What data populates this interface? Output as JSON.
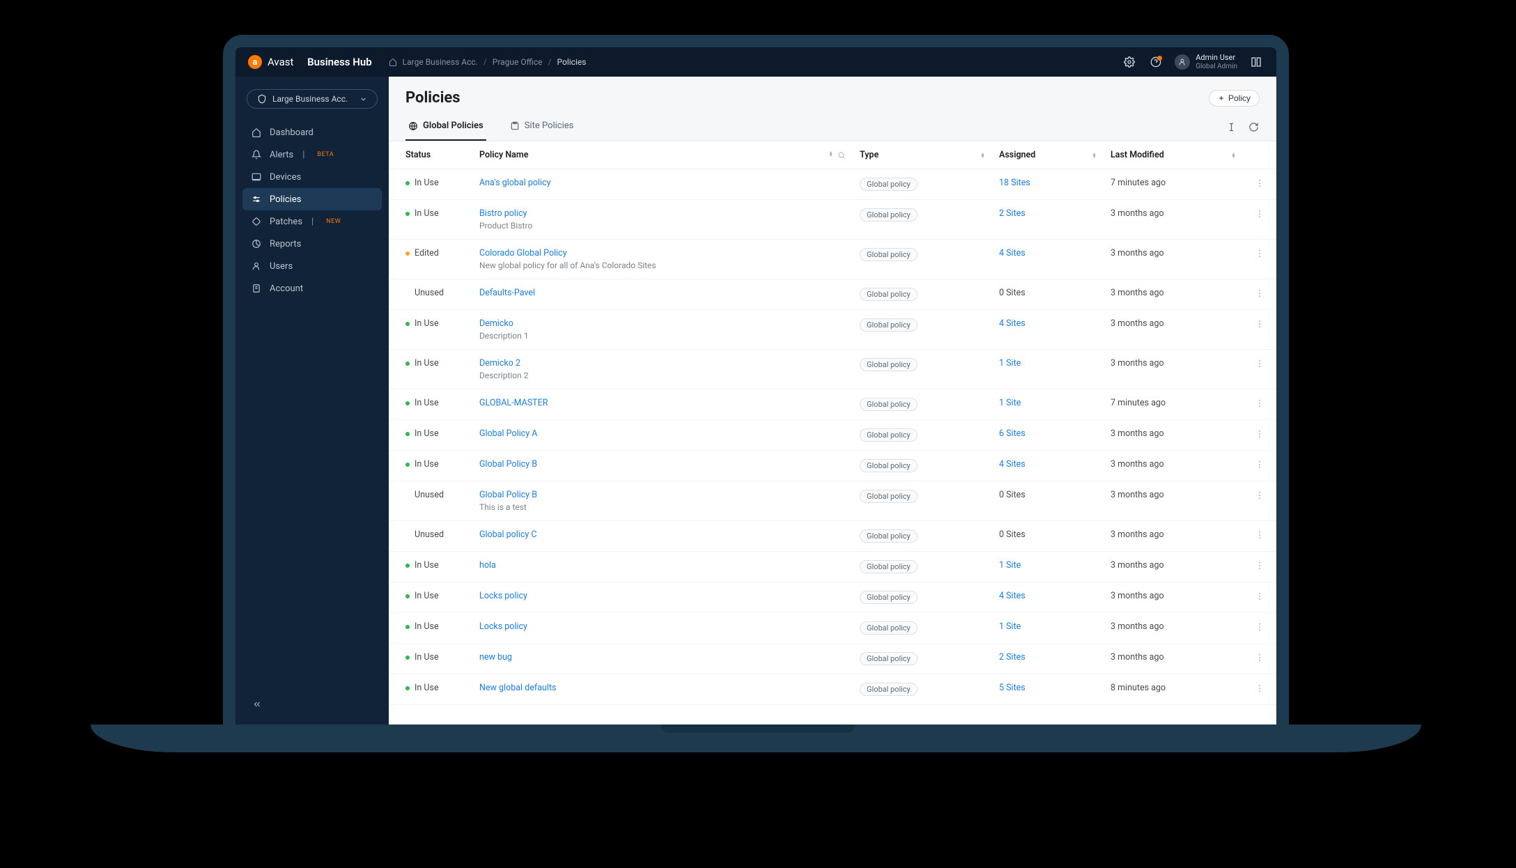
{
  "brand": {
    "name_light": "Avast",
    "name_bold": "Business Hub"
  },
  "breadcrumbs": {
    "home_label": "Large Business Acc.",
    "mid_label": "Prague Office",
    "current": "Policies"
  },
  "user": {
    "name": "Admin User",
    "role": "Global Admin"
  },
  "sidebar": {
    "org_label": "Large Business Acc.",
    "items": [
      {
        "label": "Dashboard",
        "icon": "home",
        "badge": ""
      },
      {
        "label": "Alerts",
        "icon": "bell",
        "badge": "BETA"
      },
      {
        "label": "Devices",
        "icon": "monitor",
        "badge": ""
      },
      {
        "label": "Policies",
        "icon": "sliders",
        "badge": "",
        "active": true
      },
      {
        "label": "Patches",
        "icon": "patch",
        "badge": "NEW"
      },
      {
        "label": "Reports",
        "icon": "chart",
        "badge": ""
      },
      {
        "label": "Users",
        "icon": "user",
        "badge": ""
      },
      {
        "label": "Account",
        "icon": "doc",
        "badge": ""
      }
    ]
  },
  "page": {
    "title": "Policies",
    "add_button": "Policy",
    "tabs": [
      {
        "label": "Global Policies",
        "active": true
      },
      {
        "label": "Site Policies",
        "active": false
      }
    ]
  },
  "table": {
    "headers": {
      "status": "Status",
      "name": "Policy Name",
      "type": "Type",
      "assigned": "Assigned",
      "modified": "Last Modified"
    },
    "rows": [
      {
        "status": "In Use",
        "status_dot": "green",
        "name": "Ana's global policy",
        "desc": "",
        "type": "Global policy",
        "assigned": "18 Sites",
        "assigned_nonzero": true,
        "modified": "7 minutes ago"
      },
      {
        "status": "In Use",
        "status_dot": "green",
        "name": "Bistro policy",
        "desc": "Product Bistro",
        "type": "Global policy",
        "assigned": "2 Sites",
        "assigned_nonzero": true,
        "modified": "3 months ago"
      },
      {
        "status": "Edited",
        "status_dot": "orange",
        "name": "Colorado Global Policy",
        "desc": "New global policy for all of Ana's Colorado Sites",
        "type": "Global policy",
        "assigned": "4 Sites",
        "assigned_nonzero": true,
        "modified": "3 months ago"
      },
      {
        "status": "Unused",
        "status_dot": "none",
        "name": "Defaults-Pavel",
        "desc": "",
        "type": "Global policy",
        "assigned": "0 Sites",
        "assigned_nonzero": false,
        "modified": "3 months ago"
      },
      {
        "status": "In Use",
        "status_dot": "green",
        "name": "Demicko",
        "desc": "Description 1",
        "type": "Global policy",
        "assigned": "4 Sites",
        "assigned_nonzero": true,
        "modified": "3 months ago"
      },
      {
        "status": "In Use",
        "status_dot": "green",
        "name": "Demicko 2",
        "desc": "Description 2",
        "type": "Global policy",
        "assigned": "1 Site",
        "assigned_nonzero": true,
        "modified": "3 months ago"
      },
      {
        "status": "In Use",
        "status_dot": "green",
        "name": "GLOBAL-MASTER",
        "desc": "",
        "type": "Global policy",
        "assigned": "1 Site",
        "assigned_nonzero": true,
        "modified": "7 minutes ago"
      },
      {
        "status": "In Use",
        "status_dot": "green",
        "name": "Global Policy A",
        "desc": "",
        "type": "Global policy",
        "assigned": "6 Sites",
        "assigned_nonzero": true,
        "modified": "3 months ago"
      },
      {
        "status": "In Use",
        "status_dot": "green",
        "name": "Global Policy B",
        "desc": "",
        "type": "Global policy",
        "assigned": "4 Sites",
        "assigned_nonzero": true,
        "modified": "3 months ago"
      },
      {
        "status": "Unused",
        "status_dot": "none",
        "name": "Global Policy B",
        "desc": "This is a test",
        "type": "Global policy",
        "assigned": "0 Sites",
        "assigned_nonzero": false,
        "modified": "3 months ago"
      },
      {
        "status": "Unused",
        "status_dot": "none",
        "name": "Global policy C",
        "desc": "",
        "type": "Global policy",
        "assigned": "0 Sites",
        "assigned_nonzero": false,
        "modified": "3 months ago"
      },
      {
        "status": "In Use",
        "status_dot": "green",
        "name": "hola",
        "desc": "",
        "type": "Global policy",
        "assigned": "1 Site",
        "assigned_nonzero": true,
        "modified": "3 months ago"
      },
      {
        "status": "In Use",
        "status_dot": "green",
        "name": "Locks policy",
        "desc": "",
        "type": "Global policy",
        "assigned": "4 Sites",
        "assigned_nonzero": true,
        "modified": "3 months ago"
      },
      {
        "status": "In Use",
        "status_dot": "green",
        "name": "Locks policy",
        "desc": "",
        "type": "Global policy",
        "assigned": "1 Site",
        "assigned_nonzero": true,
        "modified": "3 months ago"
      },
      {
        "status": "In Use",
        "status_dot": "green",
        "name": "new bug",
        "desc": "",
        "type": "Global policy",
        "assigned": "2 Sites",
        "assigned_nonzero": true,
        "modified": "3 months ago"
      },
      {
        "status": "In Use",
        "status_dot": "green",
        "name": "New global defaults",
        "desc": "",
        "type": "Global policy",
        "assigned": "5 Sites",
        "assigned_nonzero": true,
        "modified": "8 minutes ago"
      }
    ]
  }
}
